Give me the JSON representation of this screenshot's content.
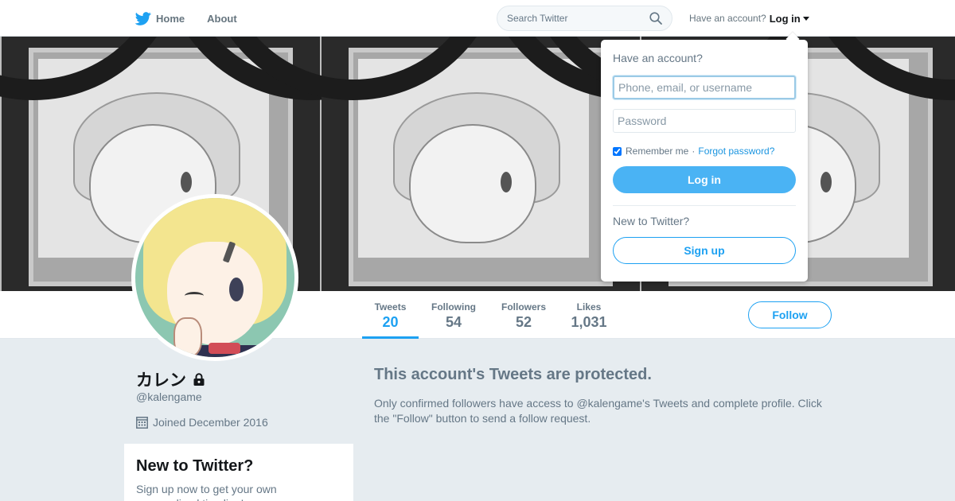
{
  "nav": {
    "home_label": "Home",
    "about_label": "About",
    "search_placeholder": "Search Twitter",
    "have_account_text": "Have an account?",
    "login_label": "Log in"
  },
  "profile": {
    "name": "カレン",
    "handle": "@kalengame",
    "joined": "Joined December 2016"
  },
  "stats": [
    {
      "label": "Tweets",
      "value": "20"
    },
    {
      "label": "Following",
      "value": "54"
    },
    {
      "label": "Followers",
      "value": "52"
    },
    {
      "label": "Likes",
      "value": "1,031"
    }
  ],
  "follow_label": "Follow",
  "protected": {
    "title": "This account's Tweets are protected.",
    "text": "Only confirmed followers have access to @kalengame's Tweets and complete profile. Click the \"Follow\" button to send a follow request."
  },
  "new_card": {
    "title": "New to Twitter?",
    "text": "Sign up now to get your own personalized timeline!"
  },
  "login_dropdown": {
    "title": "Have an account?",
    "username_placeholder": "Phone, email, or username",
    "password_placeholder": "Password",
    "remember_label": "Remember me",
    "separator": "·",
    "forgot_label": "Forgot password?",
    "login_button": "Log in",
    "new_text": "New to Twitter?",
    "signup_button": "Sign up"
  },
  "colors": {
    "accent": "#1da1f2",
    "login_button": "#4ab3f4",
    "page_background": "#e6ecf0",
    "muted_text": "#657786"
  }
}
